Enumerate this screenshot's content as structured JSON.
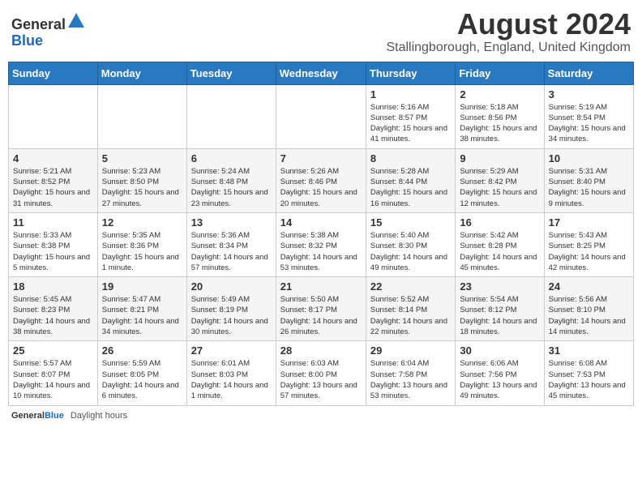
{
  "header": {
    "logo_general": "General",
    "logo_blue": "Blue",
    "month_title": "August 2024",
    "location": "Stallingborough, England, United Kingdom"
  },
  "calendar": {
    "days_of_week": [
      "Sunday",
      "Monday",
      "Tuesday",
      "Wednesday",
      "Thursday",
      "Friday",
      "Saturday"
    ],
    "weeks": [
      [
        {
          "day": "",
          "info": ""
        },
        {
          "day": "",
          "info": ""
        },
        {
          "day": "",
          "info": ""
        },
        {
          "day": "",
          "info": ""
        },
        {
          "day": "1",
          "sunrise": "Sunrise: 5:16 AM",
          "sunset": "Sunset: 8:57 PM",
          "daylight": "Daylight: 15 hours and 41 minutes."
        },
        {
          "day": "2",
          "sunrise": "Sunrise: 5:18 AM",
          "sunset": "Sunset: 8:56 PM",
          "daylight": "Daylight: 15 hours and 38 minutes."
        },
        {
          "day": "3",
          "sunrise": "Sunrise: 5:19 AM",
          "sunset": "Sunset: 8:54 PM",
          "daylight": "Daylight: 15 hours and 34 minutes."
        }
      ],
      [
        {
          "day": "4",
          "sunrise": "Sunrise: 5:21 AM",
          "sunset": "Sunset: 8:52 PM",
          "daylight": "Daylight: 15 hours and 31 minutes."
        },
        {
          "day": "5",
          "sunrise": "Sunrise: 5:23 AM",
          "sunset": "Sunset: 8:50 PM",
          "daylight": "Daylight: 15 hours and 27 minutes."
        },
        {
          "day": "6",
          "sunrise": "Sunrise: 5:24 AM",
          "sunset": "Sunset: 8:48 PM",
          "daylight": "Daylight: 15 hours and 23 minutes."
        },
        {
          "day": "7",
          "sunrise": "Sunrise: 5:26 AM",
          "sunset": "Sunset: 8:46 PM",
          "daylight": "Daylight: 15 hours and 20 minutes."
        },
        {
          "day": "8",
          "sunrise": "Sunrise: 5:28 AM",
          "sunset": "Sunset: 8:44 PM",
          "daylight": "Daylight: 15 hours and 16 minutes."
        },
        {
          "day": "9",
          "sunrise": "Sunrise: 5:29 AM",
          "sunset": "Sunset: 8:42 PM",
          "daylight": "Daylight: 15 hours and 12 minutes."
        },
        {
          "day": "10",
          "sunrise": "Sunrise: 5:31 AM",
          "sunset": "Sunset: 8:40 PM",
          "daylight": "Daylight: 15 hours and 9 minutes."
        }
      ],
      [
        {
          "day": "11",
          "sunrise": "Sunrise: 5:33 AM",
          "sunset": "Sunset: 8:38 PM",
          "daylight": "Daylight: 15 hours and 5 minutes."
        },
        {
          "day": "12",
          "sunrise": "Sunrise: 5:35 AM",
          "sunset": "Sunset: 8:36 PM",
          "daylight": "Daylight: 15 hours and 1 minute."
        },
        {
          "day": "13",
          "sunrise": "Sunrise: 5:36 AM",
          "sunset": "Sunset: 8:34 PM",
          "daylight": "Daylight: 14 hours and 57 minutes."
        },
        {
          "day": "14",
          "sunrise": "Sunrise: 5:38 AM",
          "sunset": "Sunset: 8:32 PM",
          "daylight": "Daylight: 14 hours and 53 minutes."
        },
        {
          "day": "15",
          "sunrise": "Sunrise: 5:40 AM",
          "sunset": "Sunset: 8:30 PM",
          "daylight": "Daylight: 14 hours and 49 minutes."
        },
        {
          "day": "16",
          "sunrise": "Sunrise: 5:42 AM",
          "sunset": "Sunset: 8:28 PM",
          "daylight": "Daylight: 14 hours and 45 minutes."
        },
        {
          "day": "17",
          "sunrise": "Sunrise: 5:43 AM",
          "sunset": "Sunset: 8:25 PM",
          "daylight": "Daylight: 14 hours and 42 minutes."
        }
      ],
      [
        {
          "day": "18",
          "sunrise": "Sunrise: 5:45 AM",
          "sunset": "Sunset: 8:23 PM",
          "daylight": "Daylight: 14 hours and 38 minutes."
        },
        {
          "day": "19",
          "sunrise": "Sunrise: 5:47 AM",
          "sunset": "Sunset: 8:21 PM",
          "daylight": "Daylight: 14 hours and 34 minutes."
        },
        {
          "day": "20",
          "sunrise": "Sunrise: 5:49 AM",
          "sunset": "Sunset: 8:19 PM",
          "daylight": "Daylight: 14 hours and 30 minutes."
        },
        {
          "day": "21",
          "sunrise": "Sunrise: 5:50 AM",
          "sunset": "Sunset: 8:17 PM",
          "daylight": "Daylight: 14 hours and 26 minutes."
        },
        {
          "day": "22",
          "sunrise": "Sunrise: 5:52 AM",
          "sunset": "Sunset: 8:14 PM",
          "daylight": "Daylight: 14 hours and 22 minutes."
        },
        {
          "day": "23",
          "sunrise": "Sunrise: 5:54 AM",
          "sunset": "Sunset: 8:12 PM",
          "daylight": "Daylight: 14 hours and 18 minutes."
        },
        {
          "day": "24",
          "sunrise": "Sunrise: 5:56 AM",
          "sunset": "Sunset: 8:10 PM",
          "daylight": "Daylight: 14 hours and 14 minutes."
        }
      ],
      [
        {
          "day": "25",
          "sunrise": "Sunrise: 5:57 AM",
          "sunset": "Sunset: 8:07 PM",
          "daylight": "Daylight: 14 hours and 10 minutes."
        },
        {
          "day": "26",
          "sunrise": "Sunrise: 5:59 AM",
          "sunset": "Sunset: 8:05 PM",
          "daylight": "Daylight: 14 hours and 6 minutes."
        },
        {
          "day": "27",
          "sunrise": "Sunrise: 6:01 AM",
          "sunset": "Sunset: 8:03 PM",
          "daylight": "Daylight: 14 hours and 1 minute."
        },
        {
          "day": "28",
          "sunrise": "Sunrise: 6:03 AM",
          "sunset": "Sunset: 8:00 PM",
          "daylight": "Daylight: 13 hours and 57 minutes."
        },
        {
          "day": "29",
          "sunrise": "Sunrise: 6:04 AM",
          "sunset": "Sunset: 7:58 PM",
          "daylight": "Daylight: 13 hours and 53 minutes."
        },
        {
          "day": "30",
          "sunrise": "Sunrise: 6:06 AM",
          "sunset": "Sunset: 7:56 PM",
          "daylight": "Daylight: 13 hours and 49 minutes."
        },
        {
          "day": "31",
          "sunrise": "Sunrise: 6:08 AM",
          "sunset": "Sunset: 7:53 PM",
          "daylight": "Daylight: 13 hours and 45 minutes."
        }
      ]
    ]
  },
  "footer": {
    "daylight_label": "Daylight hours"
  }
}
